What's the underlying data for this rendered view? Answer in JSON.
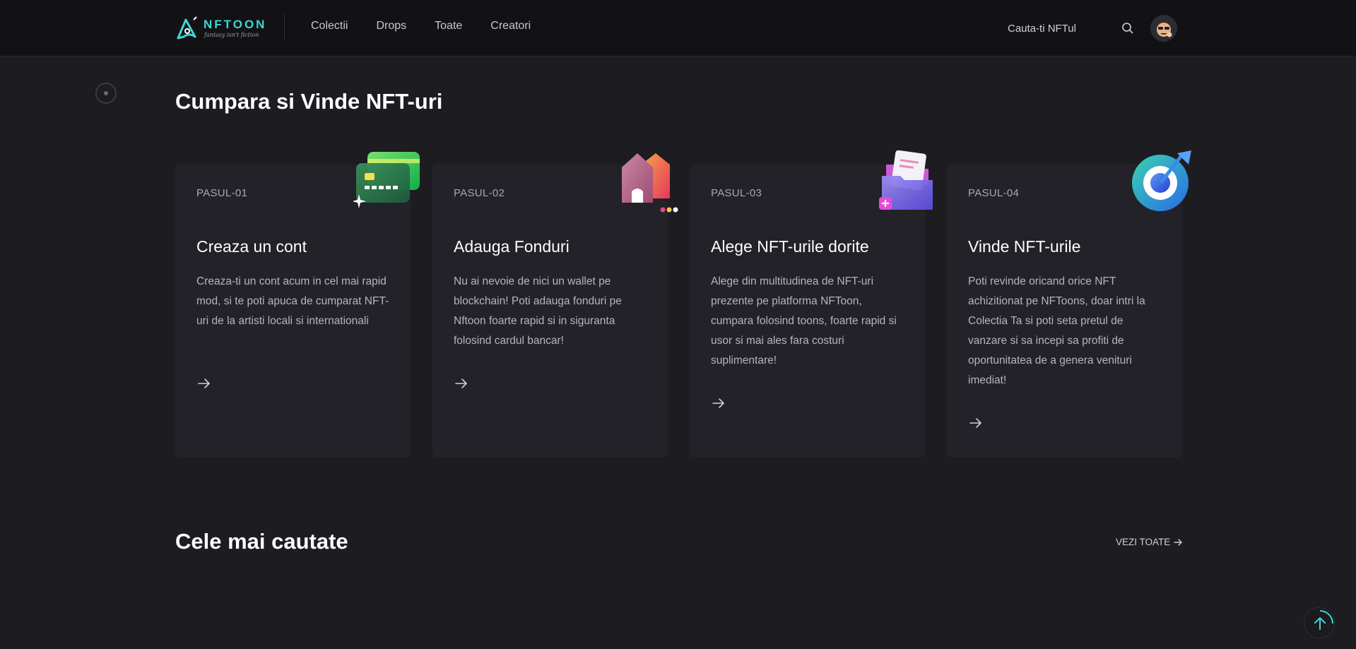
{
  "header": {
    "logo_name": "NFTOON",
    "logo_tagline": "fantasy isn't fiction",
    "nav": [
      {
        "label": "Colectii"
      },
      {
        "label": "Drops"
      },
      {
        "label": "Toate"
      },
      {
        "label": "Creatori"
      }
    ],
    "search_placeholder": "Cauta-ti NFTul",
    "search_icon": "search-icon",
    "avatar_icon": "avatar"
  },
  "steps_section": {
    "title": "Cumpara si Vinde NFT-uri",
    "cards": [
      {
        "step": "PASUL-01",
        "title": "Creaza un cont",
        "description": "Creaza-ti un cont acum in cel mai rapid mod, si te poti apuca de cumparat NFT-uri de la artisti locali si internationali",
        "icon": "credit-card-icon"
      },
      {
        "step": "PASUL-02",
        "title": "Adauga Fonduri",
        "description": "Nu ai nevoie de nici un wallet pe blockchain! Poti adauga fonduri pe Nftoon foarte rapid si in siguranta folosind cardul bancar!",
        "icon": "house-icon"
      },
      {
        "step": "PASUL-03",
        "title": "Alege NFT-urile dorite",
        "description": "Alege din multitudinea de NFT-uri prezente pe platforma NFToon, cumpara folosind toons, foarte rapid si usor si mai ales fara costuri suplimentare!",
        "icon": "folder-icon"
      },
      {
        "step": "PASUL-04",
        "title": "Vinde NFT-urile",
        "description": "Poti revinde oricand orice NFT achizitionat pe NFToons, doar intri la Colectia Ta si poti seta pretul de vanzare si sa incepi sa profiti de oportunitatea de a genera venituri imediat!",
        "icon": "target-icon"
      }
    ]
  },
  "popular_section": {
    "title": "Cele mai cautate",
    "see_all": "VEZI TOATE"
  },
  "colors": {
    "background": "#1c1c21",
    "header": "#121215",
    "card": "#222228",
    "accent": "#3fd6d0"
  }
}
